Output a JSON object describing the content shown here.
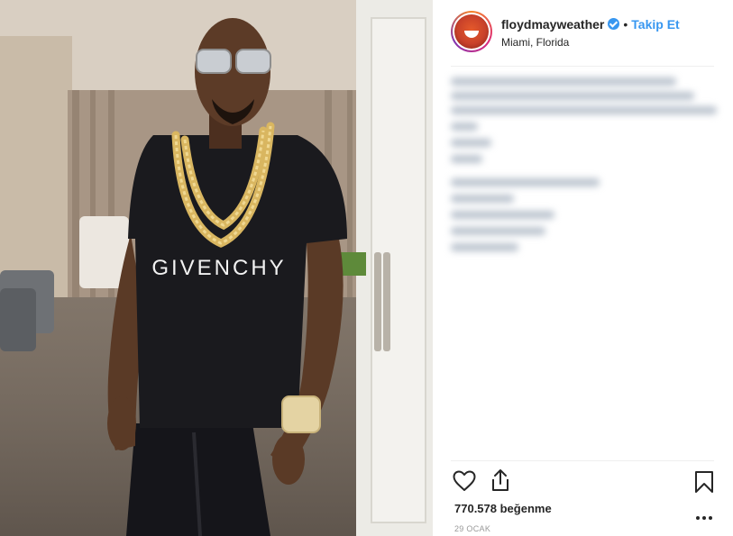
{
  "post": {
    "username": "floydmayweather",
    "follow_label": "Takip Et",
    "separator": "•",
    "location": "Miami, Florida",
    "likes": "770.578 beğenme",
    "date": "29 OCAK",
    "shirt_text": "GIVENCHY"
  },
  "icons": {
    "verified": "verified-badge-icon",
    "like": "heart-icon",
    "share": "share-icon",
    "save": "bookmark-icon",
    "more": "more-options-icon"
  },
  "colors": {
    "accent": "#3897f0",
    "text": "#262626",
    "muted": "#999999",
    "divider": "#efefef"
  }
}
